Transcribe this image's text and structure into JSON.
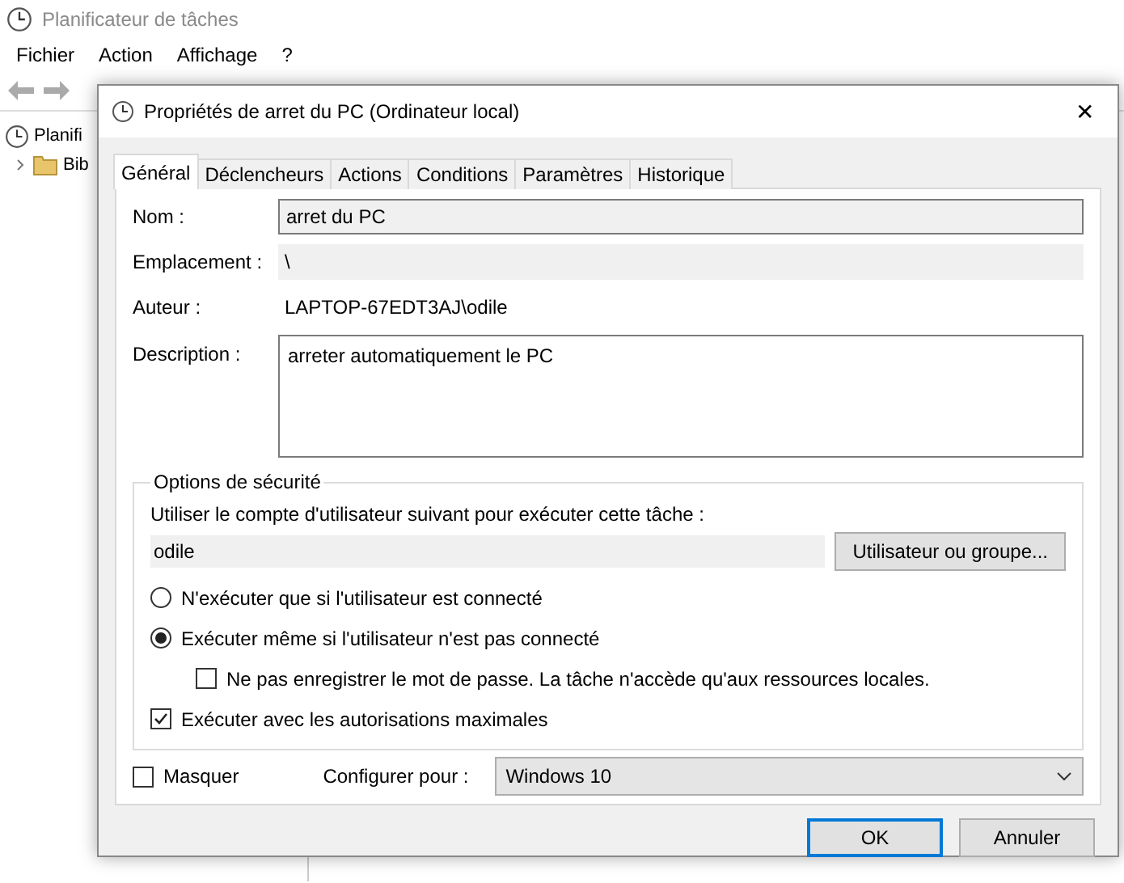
{
  "app": {
    "title": "Planificateur de tâches",
    "menu": [
      "Fichier",
      "Action",
      "Affichage",
      "?"
    ],
    "tree": [
      {
        "label": "Planifi",
        "children": [
          {
            "label": "Bib",
            "expanded": false
          }
        ]
      }
    ]
  },
  "dialog": {
    "title": "Propriétés de arret du PC (Ordinateur local)",
    "close": "✕",
    "tabs": [
      {
        "label": "Général",
        "selected": true
      },
      {
        "label": "Déclencheurs",
        "selected": false
      },
      {
        "label": "Actions",
        "selected": false
      },
      {
        "label": "Conditions",
        "selected": false
      },
      {
        "label": "Paramètres",
        "selected": false
      },
      {
        "label": "Historique",
        "selected": false
      }
    ],
    "name": {
      "label": "Nom :",
      "value": "arret du PC"
    },
    "location": {
      "label": "Emplacement :",
      "value": "\\"
    },
    "author": {
      "label": "Auteur :",
      "value": "LAPTOP-67EDT3AJ\\odile"
    },
    "description": {
      "label": "Description :",
      "value": "arreter automatiquement le PC"
    },
    "security": {
      "title": "Options de sécurité",
      "account_label": "Utiliser le compte d'utilisateur suivant pour exécuter cette tâche :",
      "account_value": "odile",
      "user_button": "Utilisateur ou groupe...",
      "options": [
        {
          "kind": "radio",
          "label": "N'exécuter que si l'utilisateur est connecté",
          "selected": false
        },
        {
          "kind": "radio",
          "label": "Exécuter même si l'utilisateur n'est pas connecté",
          "selected": true,
          "children": [
            {
              "kind": "checkbox",
              "label": "Ne pas enregistrer le mot de passe. La tâche n'accède qu'aux ressources locales.",
              "checked": false
            }
          ]
        },
        {
          "kind": "checkbox",
          "label": "Exécuter avec les autorisations maximales",
          "checked": true
        }
      ]
    },
    "hidden": {
      "label": "Masquer",
      "checked": false
    },
    "configure": {
      "label": "Configurer pour :",
      "value": "Windows 10"
    },
    "buttons": [
      {
        "label": "OK",
        "default": true
      },
      {
        "label": "Annuler",
        "default": false
      }
    ]
  }
}
